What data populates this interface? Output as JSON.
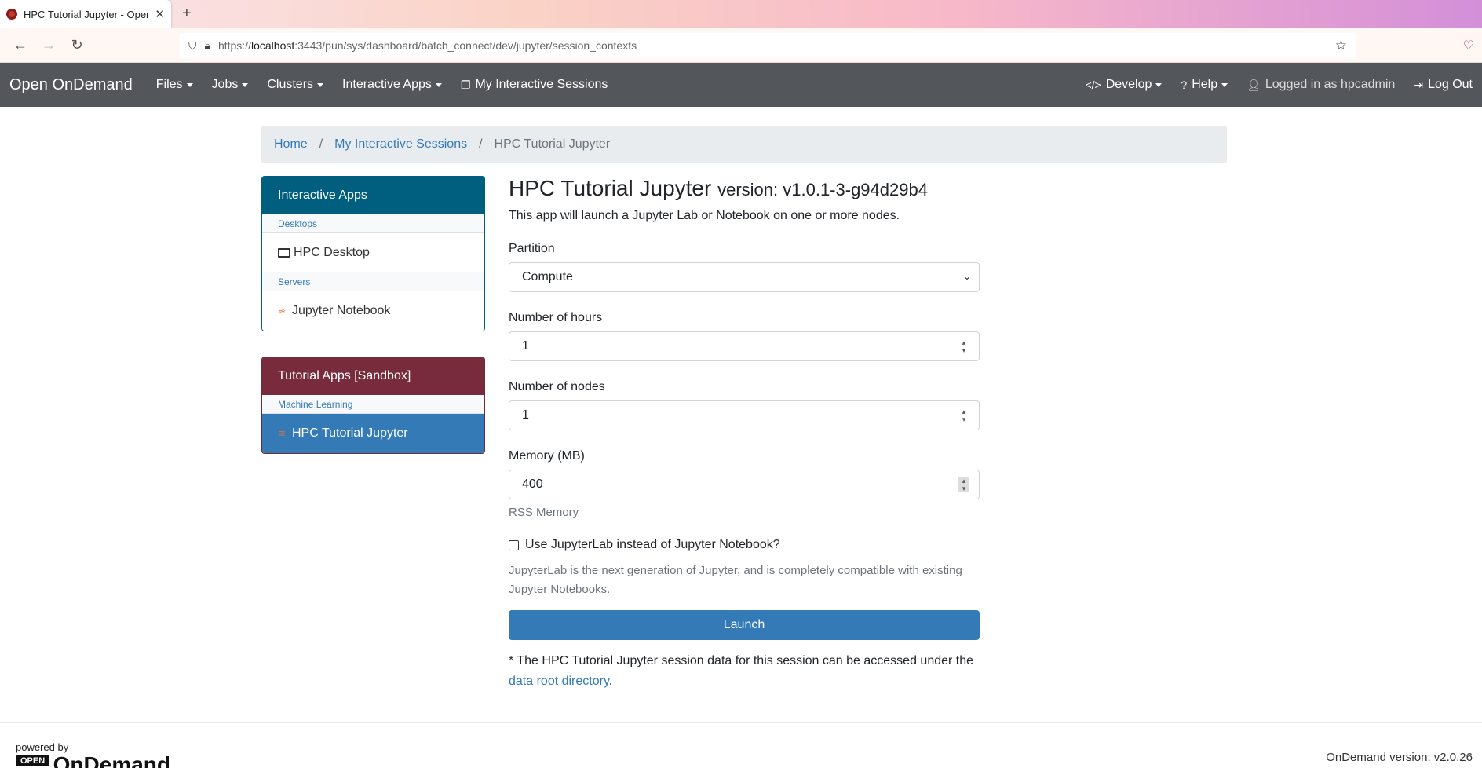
{
  "browser": {
    "tab_title": "HPC Tutorial Jupyter - Open On",
    "new_tab": "+",
    "url_prefix": "https://",
    "url_host": "localhost",
    "url_rest": ":3443/pun/sys/dashboard/batch_connect/dev/jupyter/session_contexts"
  },
  "nav": {
    "brand": "Open OnDemand",
    "files": "Files",
    "jobs": "Jobs",
    "clusters": "Clusters",
    "interactive_apps": "Interactive Apps",
    "my_sessions": "My Interactive Sessions",
    "develop": "Develop",
    "help": "Help",
    "logged_in": "Logged in as hpcadmin",
    "logout": "Log Out"
  },
  "breadcrumb": {
    "home": "Home",
    "sessions": "My Interactive Sessions",
    "current": "HPC Tutorial Jupyter"
  },
  "sidebar": {
    "panel1": {
      "title": "Interactive Apps",
      "cat1": "Desktops",
      "item1": "HPC Desktop",
      "cat2": "Servers",
      "item2": "Jupyter Notebook"
    },
    "panel2": {
      "title": "Tutorial Apps [Sandbox]",
      "cat1": "Machine Learning",
      "item1": "HPC Tutorial Jupyter"
    }
  },
  "form": {
    "title": "HPC Tutorial Jupyter",
    "version": "version: v1.0.1-3-g94d29b4",
    "description": "This app will launch a Jupyter Lab or Notebook on one or more nodes.",
    "partition_label": "Partition",
    "partition_value": "Compute",
    "hours_label": "Number of hours",
    "hours_value": "1",
    "nodes_label": "Number of nodes",
    "nodes_value": "1",
    "memory_label": "Memory (MB)",
    "memory_value": "400",
    "memory_help": "RSS Memory",
    "jupyterlab_label": "Use JupyterLab instead of Jupyter Notebook?",
    "jupyterlab_help_1": "JupyterLab is the next generation of Jupyter, and is completely compatible with existing",
    "jupyterlab_help_2": "Jupyter Notebooks.",
    "launch": "Launch",
    "note_text": "* The HPC Tutorial Jupyter session data for this session can be accessed under the",
    "note_link": "data root directory",
    "note_end": "."
  },
  "footer": {
    "powered_by": "powered by",
    "logo_open": "OPEN",
    "logo_ondemand": "OnDemand",
    "version": "OnDemand version: v2.0.26"
  }
}
